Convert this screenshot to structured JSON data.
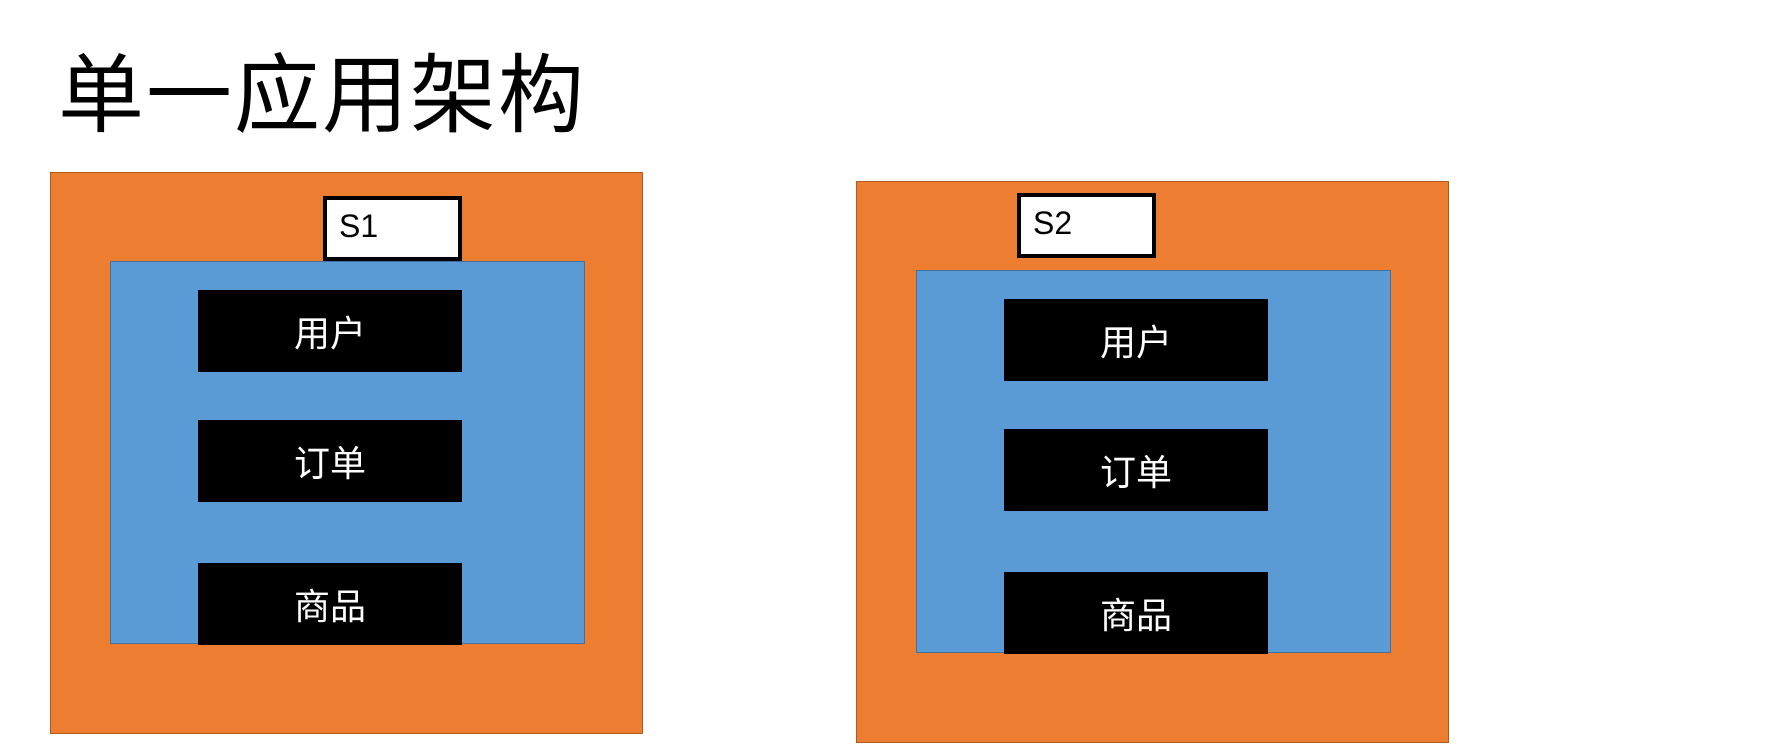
{
  "title": "单一应用架构",
  "servers": [
    {
      "label": "S1",
      "modules": [
        "用户",
        "订单",
        "商品"
      ]
    },
    {
      "label": "S2",
      "modules": [
        "用户",
        "订单",
        "商品"
      ]
    }
  ],
  "colors": {
    "server_fill": "#ed7d31",
    "container_fill": "#5b9bd5",
    "module_fill": "#000000",
    "module_text": "#ffffff"
  }
}
